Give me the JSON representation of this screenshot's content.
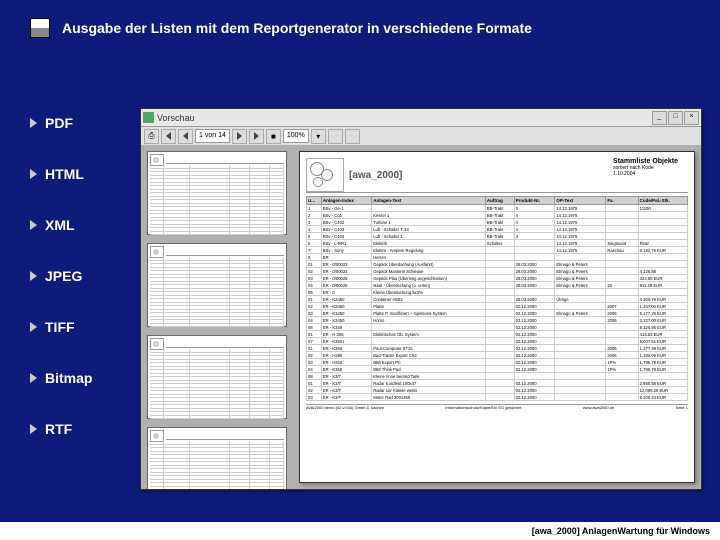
{
  "title": "Ausgabe der Listen mit dem Reportgenerator in verschiedene Formate",
  "formats": [
    "PDF",
    "HTML",
    "XML",
    "JPEG",
    "TIFF",
    "Bitmap",
    "RTF"
  ],
  "preview": {
    "window_title": "Vorschau",
    "toolbar": {
      "page_info": "1 von 14",
      "zoom": "100%"
    },
    "page": {
      "brand": "[awa_2000]",
      "report_title": "Stammliste Objekte",
      "report_sub1": "sortiert nach Kode",
      "report_sub2": "1.10.2004",
      "columns": [
        "U...",
        "Anlagen-Index",
        "Anlagen-Text",
        "Auftrag",
        "Produkt-Nr.",
        "OP-Text",
        "Fa.",
        "Code/Pal.-Stk."
      ],
      "rows": [
        [
          "1",
          "BSv - Ge-1",
          "",
          "BB-Trakt",
          "3",
          "14.12.1975",
          "",
          "11100"
        ],
        [
          "2",
          "BSv - Co1",
          "Kessel 1",
          "BB-Trakt",
          "4",
          "14.12.1975",
          "",
          ""
        ],
        [
          "3",
          "BSv - C402",
          "Turbine 1",
          "BB-Trakt",
          "4",
          "14.12.1975",
          "",
          ""
        ],
        [
          "4",
          "BSv - C403",
          "Luft - Schalter T-23",
          "BB-Trakt",
          "4",
          "14.12.1975",
          "",
          ""
        ],
        [
          "5",
          "BSv - C404",
          "Luft - Schalter 1",
          "BB-Trakt",
          "4",
          "14.12.1975",
          "",
          ""
        ],
        [
          "6",
          "BSv - L-RR1",
          "Elektrik",
          "Schalter",
          "",
          "14.12.1975",
          "Siegmund",
          "Platz"
        ],
        [
          "7",
          "BSv - Sony",
          "Elektro - Ampere Regelung",
          "",
          "",
          "14.12.1975",
          "Raschau",
          "6.182.76 EUR"
        ],
        [
          "8",
          "ER",
          "Herren",
          "",
          "",
          "",
          "",
          ""
        ],
        [
          "01",
          "ER - 0/00023",
          "Gepäck Überdachung (Ausfahrt)",
          "",
          "28.03.2000",
          "Elmago & Peters",
          "",
          ""
        ],
        [
          "02",
          "ER - 0/00024",
          "Gepäck Manterin Schleuse",
          "",
          "28.03.2000",
          "Elmago & Peters",
          "",
          "4.126.88"
        ],
        [
          "03",
          "ER - 0/00025",
          "Gepäck Plau (Überweg angeschlossen)",
          "",
          "28.03.2000",
          "Elmago & Peters",
          "",
          "324.50 EUR"
        ],
        [
          "04",
          "ER - 0/00026",
          "staat - Überdeckung (o. unten)",
          "",
          "28.03.2000",
          "Elmago & Peters",
          "20",
          "811.28 EUR"
        ],
        [
          "05",
          "ER - 0",
          "Kleine Überdachung 5x3%",
          "",
          "",
          "",
          "",
          ""
        ],
        [
          "01",
          "ER - K3450",
          "Container H503",
          "",
          "28.03.2000",
          "Übrige",
          "",
          "4.300.79 EUR"
        ],
        [
          "02",
          "ER - K3450",
          "Platte",
          "",
          "02.12.2000",
          "",
          "2007",
          "1.247.00 EUR"
        ],
        [
          "03",
          "ER - K3450",
          "Platte P. modifiziert + Injektions-System",
          "",
          "02.12.2000",
          "Elmago & Peters",
          "2006",
          "5.177.29 EUR"
        ],
        [
          "04",
          "ER - K3450",
          "Homo",
          "",
          "02.12.2000",
          "",
          "2006",
          "3.227.00 EUR"
        ],
        [
          "06",
          "ER - K349",
          "",
          "",
          "02.12.2000",
          "",
          "",
          "8.320.85 EUR"
        ],
        [
          "01",
          "ER - H 306",
          "Elektrisches Ob. System",
          "",
          "02.12.2000",
          "",
          "",
          "414.63 EUR"
        ],
        [
          "07",
          "ER - K3501",
          "",
          "",
          "02.12.2000",
          "",
          "",
          "5.007.51 EUR"
        ],
        [
          "01",
          "ER - K356",
          "Paul-Computer ST15",
          "",
          "02.12.2000",
          "",
          "2006",
          "1.377.49 EUR"
        ],
        [
          "02",
          "ER - H355",
          "Bad-Tracks Export C93",
          "",
          "02.12.2000",
          "",
          "2006",
          "1.182.06 EUR"
        ],
        [
          "03",
          "ER - H316",
          "IBM Export PC",
          "",
          "02.12.2000",
          "",
          "1P%",
          "1.795.79 EUR"
        ],
        [
          "04",
          "ER - K359",
          "IBM Think Pad",
          "",
          "02.12.2000",
          "",
          "1P%",
          "1.795.79 EUR"
        ],
        [
          "08",
          "ER - K3/7",
          "Kleine rinne berond Tank",
          "",
          "",
          "",
          "",
          ""
        ],
        [
          "01",
          "ER - K3/T",
          "Radar Kordfeld 100x47",
          "",
          "02.12.2000",
          "",
          "",
          "2.650.56 EUR"
        ],
        [
          "02",
          "ER - K3/T",
          "Radar 1er Klasse weiss",
          "",
          "02.12.2000",
          "",
          "",
          "12.090.29 EUR"
        ],
        [
          "03",
          "ER - K3/T",
          "Motor Rad 3001450",
          "",
          "02.12.2000",
          "",
          "",
          "8.200.44 EUR"
        ]
      ],
      "footer_left": "AVA/2000 demo (02.v.034) Gmbh,D Sachen",
      "footer_center": "Informationsschutz/Kopie/Ein EG gesichert",
      "footer_right": "www.awa2000.de",
      "footer_page": "Seite 1"
    }
  },
  "footer": "[awa_2000]  AnlagenWartung für Windows"
}
